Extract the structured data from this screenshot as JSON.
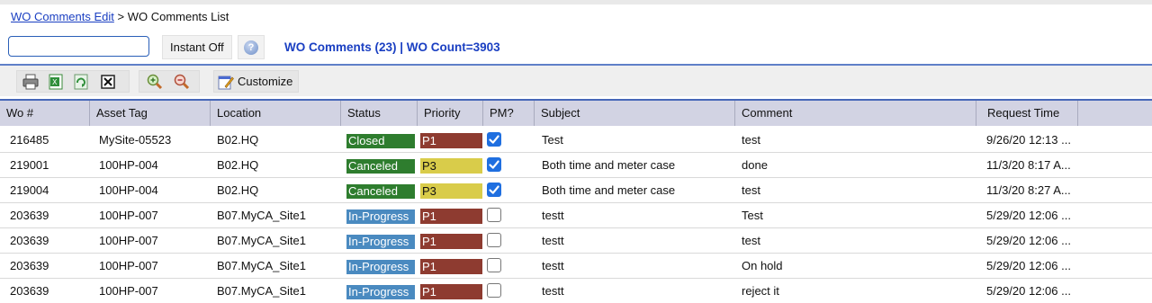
{
  "breadcrumb": {
    "link": "WO Comments Edit",
    "sep": ">",
    "current": "WO Comments List"
  },
  "search": {
    "value": "",
    "instant_label": "Instant Off",
    "help_glyph": "?"
  },
  "counts": {
    "text": "WO Comments (23)  |  WO Count=3903"
  },
  "toolbar": {
    "icons": [
      "print-icon",
      "export-excel-icon",
      "export-refresh-icon",
      "close-box-icon",
      "zoom-in-icon",
      "zoom-out-icon"
    ],
    "customize_label": "Customize"
  },
  "columns": [
    "Wo #",
    "Asset Tag",
    "Location",
    "Status",
    "Priority",
    "PM?",
    "Subject",
    "Comment",
    "Request Time"
  ],
  "colors": {
    "Closed": "#2e7d2e",
    "Canceled": "#2e7d2e",
    "In-Progress": "#4a8ac0",
    "P1": "#8e3b30",
    "P3": "#d9cc4a",
    "accent": "#1a3fc2"
  },
  "rows": [
    {
      "wo": "216485",
      "asset": "MySite-05523",
      "location": "B02.HQ",
      "status": "Closed",
      "priority": "P1",
      "pm": true,
      "subject": "Test",
      "comment": "test",
      "time": "9/26/20 12:13 ..."
    },
    {
      "wo": "219001",
      "asset": "100HP-004",
      "location": "B02.HQ",
      "status": "Canceled",
      "priority": "P3",
      "pm": true,
      "subject": "Both time and meter case",
      "comment": "done",
      "time": "11/3/20 8:17 A..."
    },
    {
      "wo": "219004",
      "asset": "100HP-004",
      "location": "B02.HQ",
      "status": "Canceled",
      "priority": "P3",
      "pm": true,
      "subject": "Both time and meter case",
      "comment": "test",
      "time": "11/3/20 8:27 A..."
    },
    {
      "wo": "203639",
      "asset": "100HP-007",
      "location": "B07.MyCA_Site1",
      "status": "In-Progress",
      "priority": "P1",
      "pm": false,
      "subject": "testt",
      "comment": "Test",
      "time": "5/29/20 12:06 ..."
    },
    {
      "wo": "203639",
      "asset": "100HP-007",
      "location": "B07.MyCA_Site1",
      "status": "In-Progress",
      "priority": "P1",
      "pm": false,
      "subject": "testt",
      "comment": "test",
      "time": "5/29/20 12:06 ..."
    },
    {
      "wo": "203639",
      "asset": "100HP-007",
      "location": "B07.MyCA_Site1",
      "status": "In-Progress",
      "priority": "P1",
      "pm": false,
      "subject": "testt",
      "comment": "On hold",
      "time": "5/29/20 12:06 ..."
    },
    {
      "wo": "203639",
      "asset": "100HP-007",
      "location": "B07.MyCA_Site1",
      "status": "In-Progress",
      "priority": "P1",
      "pm": false,
      "subject": "testt",
      "comment": "reject it",
      "time": "5/29/20 12:06 ..."
    }
  ]
}
